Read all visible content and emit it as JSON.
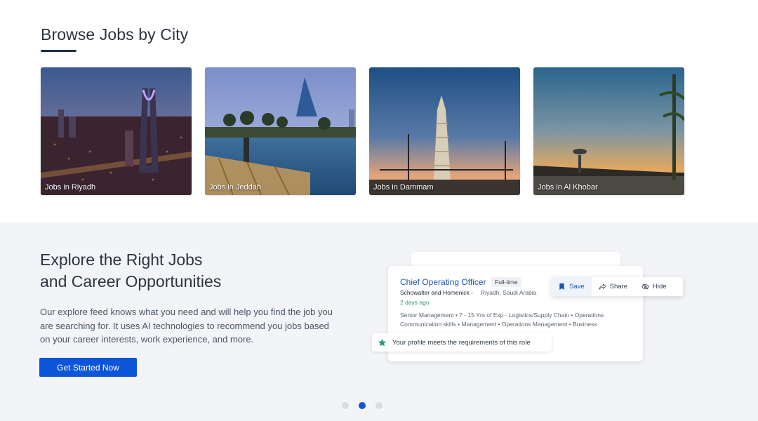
{
  "browse": {
    "title": "Browse Jobs by City",
    "cities": [
      {
        "label": "Jobs in Riyadh"
      },
      {
        "label": "Jobs in Jeddah"
      },
      {
        "label": "Jobs in Dammam"
      },
      {
        "label": "Jobs in Al Khobar"
      }
    ]
  },
  "explore": {
    "title_line1": "Explore the Right Jobs",
    "title_line2": "and Career Opportunities",
    "description": "Our explore feed knows what you need and will help you find the job you are searching for. It uses AI technologies to recommend you jobs based on your career interests, work experience, and more.",
    "cta_label": "Get Started Now"
  },
  "job_card": {
    "title": "Chief Operating Officer",
    "type": "Full-time",
    "company": "Schowalter and Homenick -",
    "location": "Riyadh, Saudi Arabia",
    "posted": "2 days ago",
    "tags_line1": "Senior Management • 7 - 15 Yrs of Exp · Logistics/Supply Chain • Operations",
    "tags_line2": "Communication skills • Management • Operations Management • Business"
  },
  "actions": {
    "save": "Save",
    "share": "Share",
    "hide": "Hide"
  },
  "match_badge": "Your profile meets the requirements of this role",
  "carousel": {
    "count": 3,
    "active": 2
  },
  "colors": {
    "primary": "#0d55d8",
    "link": "#1a56b7",
    "success": "#2a9a7d",
    "section_bg": "#f2f4f7"
  },
  "icons": [
    "bookmark-icon",
    "share-icon",
    "eye-off-icon",
    "star-icon"
  ]
}
